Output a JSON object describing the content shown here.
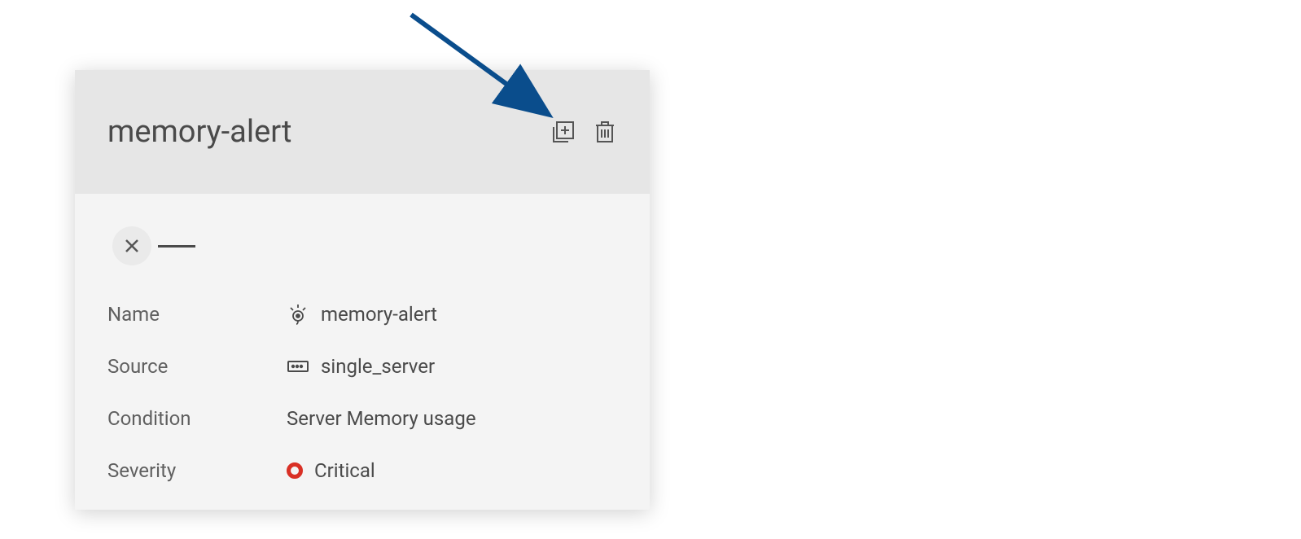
{
  "card": {
    "title": "memory-alert",
    "details": {
      "name": {
        "label": "Name",
        "value": "memory-alert"
      },
      "source": {
        "label": "Source",
        "value": "single_server"
      },
      "condition": {
        "label": "Condition",
        "value": "Server Memory usage"
      },
      "severity": {
        "label": "Severity",
        "value": "Critical",
        "color": "#d93025"
      }
    }
  }
}
